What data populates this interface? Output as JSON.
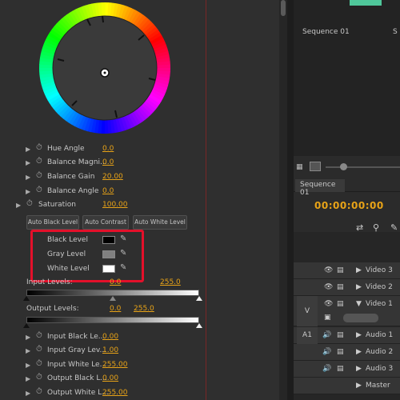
{
  "effect_controls": {
    "params": [
      {
        "label": "Hue Angle",
        "value": "0.0"
      },
      {
        "label": "Balance Magni...",
        "value": "0.0"
      },
      {
        "label": "Balance Gain",
        "value": "20.00"
      },
      {
        "label": "Balance Angle",
        "value": "0.0"
      },
      {
        "label": "Saturation",
        "value": "100.00"
      }
    ],
    "buttons": {
      "auto_black": "Auto Black Level",
      "auto_contrast": "Auto Contrast",
      "auto_white": "Auto White Level"
    },
    "levels": {
      "black": "Black Level",
      "gray": "Gray Level",
      "white": "White Level"
    },
    "input_levels": {
      "label": "Input Levels:",
      "low": "0.0",
      "high": "255.0"
    },
    "output_levels": {
      "label": "Output Levels:",
      "low": "0.0",
      "high": "255.0"
    },
    "extra_params": [
      {
        "label": "Input Black Le...",
        "value": "0.00"
      },
      {
        "label": "Input Gray Lev...",
        "value": "1.00"
      },
      {
        "label": "Input White Le...",
        "value": "255.00"
      },
      {
        "label": "Output Black L...",
        "value": "0.00"
      },
      {
        "label": "Output White L...",
        "value": "255.00"
      }
    ]
  },
  "monitor": {
    "title": "Sequence 01",
    "title_short": "S"
  },
  "timeline": {
    "tab": "Sequence 01",
    "timecode": "00:00:00:00",
    "tracks": [
      {
        "side": "",
        "name": "Video 3"
      },
      {
        "side": "",
        "name": "Video 2"
      },
      {
        "side": "V",
        "name": "Video 1"
      },
      {
        "side": "A1",
        "name": "Audio 1"
      },
      {
        "side": "",
        "name": "Audio 2"
      },
      {
        "side": "",
        "name": "Audio 3"
      },
      {
        "side": "",
        "name": "Master"
      }
    ]
  },
  "colors": {
    "accent": "#e8a317",
    "highlight": "#e3102a"
  }
}
